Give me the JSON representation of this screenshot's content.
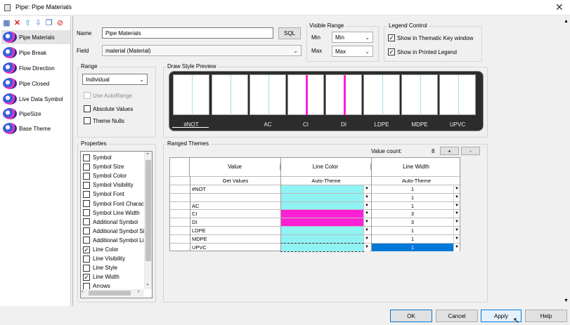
{
  "window": {
    "title": "Pipe: Pipe Materials",
    "close_glyph": "✕"
  },
  "toolbar": {
    "icons": [
      "new-theme-icon",
      "delete-icon",
      "move-up-icon",
      "move-down-icon",
      "copy-icon",
      "disable-icon"
    ],
    "glyphs": [
      "▦",
      "✕",
      "⇧",
      "⇩",
      "❐",
      "⊘"
    ]
  },
  "nav": {
    "items": [
      {
        "label": "Pipe Materials",
        "selected": true
      },
      {
        "label": "Pipe Break"
      },
      {
        "label": "Flow Direction"
      },
      {
        "label": "Pipe Closed"
      },
      {
        "label": "Live Data Symbol"
      },
      {
        "label": "PipeSize"
      },
      {
        "label": "Base Theme"
      }
    ]
  },
  "name": {
    "label": "Name",
    "value": "Pipe Materials",
    "sql_label": "SQL"
  },
  "field": {
    "label": "Field",
    "value": "material (Material)"
  },
  "visible_range": {
    "title": "Visible Range",
    "min_label": "Min",
    "min_value": "Min",
    "max_label": "Max",
    "max_value": "Max"
  },
  "legend": {
    "title": "Legend Control",
    "thematic_label": "Show in Thematic Key window",
    "thematic_checked": true,
    "printed_label": "Show in Printed Legend",
    "printed_checked": true
  },
  "range": {
    "title": "Range",
    "mode": "Individual",
    "use_autorange": "Use AutoRange",
    "absolute_values": "Absolute Values",
    "theme_nulls": "Theme Nulls"
  },
  "preview": {
    "title": "Draw Style Preview",
    "items": [
      {
        "label": "#NOT",
        "color": "#9fe0e6",
        "wide": false
      },
      {
        "label": "",
        "color": "#9fe0e6",
        "wide": false
      },
      {
        "label": "AC",
        "color": "#9fe0e6",
        "wide": false
      },
      {
        "label": "CI",
        "color": "#ff1fd6",
        "wide": true
      },
      {
        "label": "DI",
        "color": "#ff1fd6",
        "wide": true
      },
      {
        "label": "LDPE",
        "color": "#9fe0e6",
        "wide": false
      },
      {
        "label": "MDPE",
        "color": "#9fe0e6",
        "wide": false
      },
      {
        "label": "UPVC",
        "color": "#9fe0e6",
        "wide": false
      }
    ]
  },
  "properties": {
    "title": "Properties",
    "items": [
      {
        "label": "Symbol",
        "checked": false
      },
      {
        "label": "Symbol Size",
        "checked": false
      },
      {
        "label": "Symbol Color",
        "checked": false
      },
      {
        "label": "Symbol Visibility",
        "checked": false
      },
      {
        "label": "Symbol Font",
        "checked": false
      },
      {
        "label": "Symbol Font Charact",
        "checked": false
      },
      {
        "label": "Symbol Line Width",
        "checked": false
      },
      {
        "label": "Additional Symbol",
        "checked": false
      },
      {
        "label": "Additional Symbol Si",
        "checked": false
      },
      {
        "label": "Additional Symbol Li",
        "checked": false
      },
      {
        "label": "Line Color",
        "checked": true
      },
      {
        "label": "Line Visibility",
        "checked": false
      },
      {
        "label": "Line Style",
        "checked": false
      },
      {
        "label": "Line Width",
        "checked": true
      },
      {
        "label": "Arrows",
        "checked": false
      }
    ]
  },
  "ranged": {
    "title": "Ranged Themes",
    "value_count_label": "Value count:",
    "value_count": "8",
    "plus": "+",
    "minus": "-",
    "col_value": "Value",
    "col_color": "Line Color",
    "col_width": "Line Width",
    "sub_value": "Get Values",
    "sub_color": "Auto-Theme",
    "sub_width": "Auto-Theme",
    "rows": [
      {
        "value": "#NOT",
        "color": "#8ff3f4",
        "width": "1"
      },
      {
        "value": "",
        "color": "#8ff3f4",
        "width": "1"
      },
      {
        "value": "AC",
        "color": "#8ff3f4",
        "width": "1"
      },
      {
        "value": "CI",
        "color": "#ff1fd6",
        "width": "3"
      },
      {
        "value": "DI",
        "color": "#ff1fd6",
        "width": "3"
      },
      {
        "value": "LDPE",
        "color": "#8ff3f4",
        "width": "1"
      },
      {
        "value": "MDPE",
        "color": "#8ff3f4",
        "width": "1"
      },
      {
        "value": "UPVC",
        "color": "#8ff3f4",
        "width": "1",
        "selected": true
      }
    ]
  },
  "buttons": {
    "ok": "OK",
    "cancel": "Cancel",
    "apply": "Apply",
    "help": "Help"
  }
}
